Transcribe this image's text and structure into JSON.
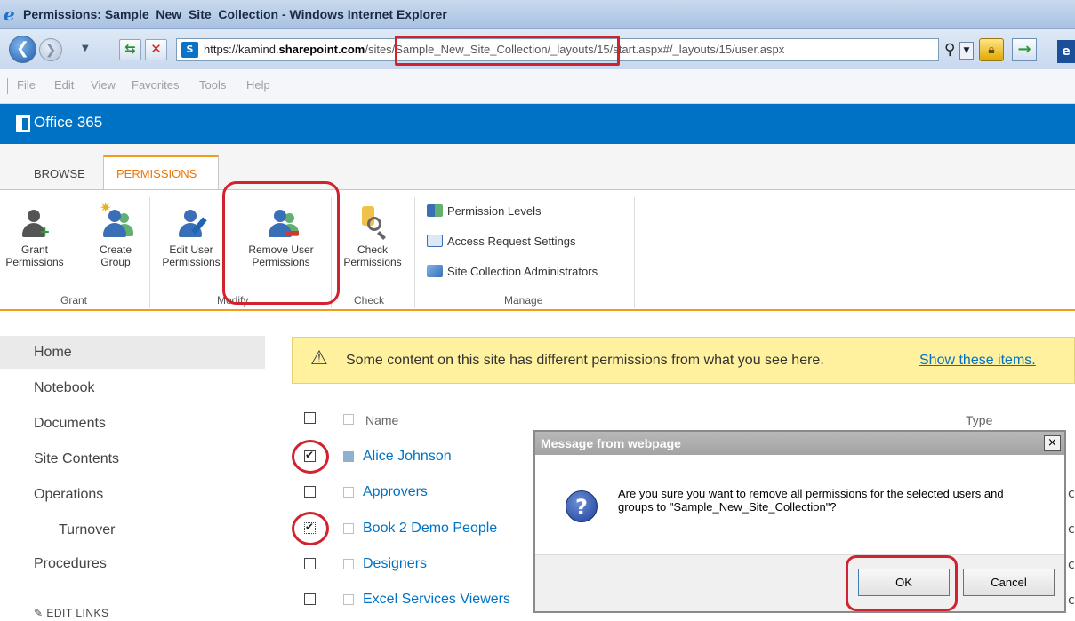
{
  "window": {
    "title": "Permissions: Sample_New_Site_Collection - Windows Internet Explorer",
    "url_host_prefix": "https://kamind.",
    "url_host_bold": "sharepoint.com",
    "url_path": "/sites/Sample_New_Site_Collection/_layouts/15/start.aspx#/_layouts/15/user.aspx",
    "menu": [
      "File",
      "Edit",
      "View",
      "Favorites",
      "Tools",
      "Help"
    ]
  },
  "suite_bar": {
    "brand": "Office 365"
  },
  "ribbon": {
    "tabs": [
      "BROWSE",
      "PERMISSIONS"
    ],
    "active_tab": "PERMISSIONS",
    "groups": {
      "grant": {
        "label": "Grant",
        "grant_permissions": [
          "Grant",
          "Permissions"
        ],
        "create_group": [
          "Create",
          "Group"
        ]
      },
      "modify": {
        "label": "Modify",
        "edit_user_permissions": [
          "Edit User",
          "Permissions"
        ],
        "remove_user_permissions": [
          "Remove User",
          "Permissions"
        ]
      },
      "check": {
        "label": "Check",
        "check_permissions": [
          "Check",
          "Permissions"
        ]
      },
      "manage": {
        "label": "Manage",
        "items": [
          "Permission Levels",
          "Access Request Settings",
          "Site Collection Administrators"
        ]
      }
    }
  },
  "left_nav": {
    "items": [
      "Home",
      "Notebook",
      "Documents",
      "Site Contents",
      "Operations",
      "Turnover",
      "Procedures"
    ],
    "edit_links": "EDIT LINKS"
  },
  "warning": {
    "text": "Some content on this site has different permissions from what you see here.",
    "link": "Show these items."
  },
  "list": {
    "columns": {
      "name": "Name",
      "type": "Type"
    },
    "rows": [
      {
        "name": "Alice Johnson",
        "checked": true
      },
      {
        "name": "Approvers",
        "checked": false
      },
      {
        "name": "Book 2 Demo People",
        "checked": true
      },
      {
        "name": "Designers",
        "checked": false
      },
      {
        "name": "Excel Services Viewers",
        "checked": false
      }
    ]
  },
  "dialog": {
    "title": "Message from webpage",
    "close": "×",
    "message": "Are you sure you want to remove all permissions for the selected users and groups to \"Sample_New_Site_Collection\"?",
    "ok_label": "OK",
    "cancel_label": "Cancel"
  },
  "colors": {
    "suite_bar": "#0072c6",
    "accent_orange": "#f29c1b",
    "highlight_red": "#d2222d",
    "warning_bg": "#fff19d",
    "link": "#0072c6"
  }
}
